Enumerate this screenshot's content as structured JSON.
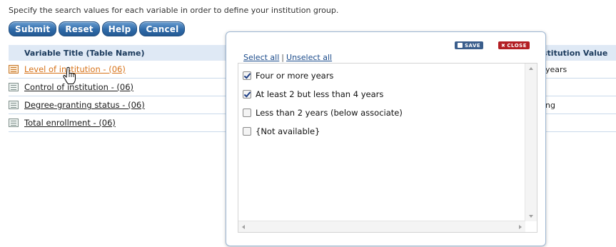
{
  "instructions": "Specify the search values for each variable in order to define your institution group.",
  "buttons": {
    "submit": "Submit",
    "reset": "Reset",
    "help": "Help",
    "cancel": "Cancel"
  },
  "table": {
    "col_variable": "Variable Title (Table Name)",
    "col_value": "stitution Value",
    "rows": [
      {
        "label": "Level of institution  - (06)",
        "value": "years"
      },
      {
        "label": "Control of institution  - (06)",
        "value": ""
      },
      {
        "label": "Degree-granting status  - (06)",
        "value": "ng"
      },
      {
        "label": "Total enrollment  - (06)",
        "value": ""
      }
    ]
  },
  "popup": {
    "save_label": "SAVE",
    "close_label": "CLOSE",
    "select_all": "Select all",
    "separator": "|",
    "unselect_all": "Unselect all",
    "options": [
      {
        "label": "Four or more years",
        "checked": true
      },
      {
        "label": "At least 2 but less than 4 years",
        "checked": true
      },
      {
        "label": "Less than 2 years (below associate)",
        "checked": false
      },
      {
        "label": "{Not available}",
        "checked": false
      }
    ]
  },
  "colors": {
    "button_blue": "#2f6aa8",
    "active_link": "#d7731a",
    "close_red": "#b31f24",
    "header_bg": "#dfe9f5"
  },
  "icons": {
    "row_icon": "table-document-icon",
    "cursor": "hand-pointer-icon",
    "save": "disk-icon",
    "close": "x-icon"
  }
}
